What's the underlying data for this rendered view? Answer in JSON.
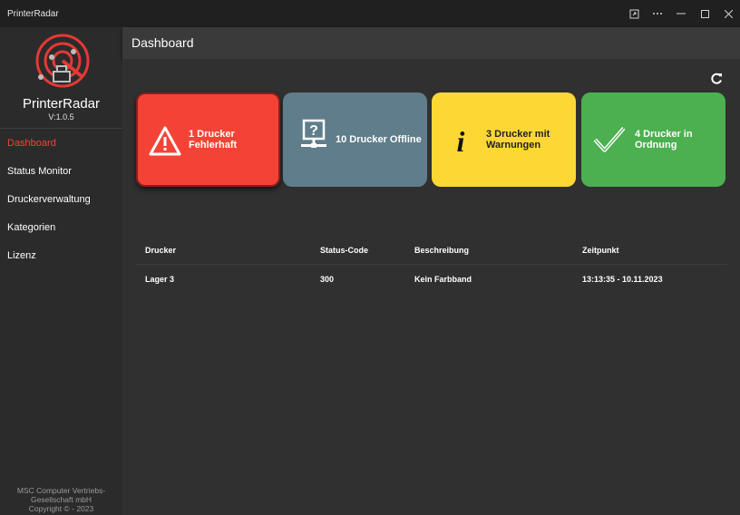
{
  "window": {
    "title": "PrinterRadar",
    "controls": [
      "restore-icon",
      "more-icon",
      "minimize-icon",
      "maximize-icon",
      "close-icon"
    ]
  },
  "sidebar": {
    "app_name": "PrinterRadar",
    "version": "V:1.0.5",
    "items": [
      {
        "label": "Dashboard",
        "active": true
      },
      {
        "label": "Status Monitor",
        "active": false
      },
      {
        "label": "Druckerverwaltung",
        "active": false
      },
      {
        "label": "Kategorien",
        "active": false
      },
      {
        "label": "Lizenz",
        "active": false
      }
    ],
    "copyright": [
      "MSC Computer Vertriebs-",
      "Gesellschaft mbH",
      "Copyright © - 2023"
    ]
  },
  "header": {
    "title": "Dashboard"
  },
  "cards": [
    {
      "line1": "1 Drucker",
      "line2": "Fehlerhaft",
      "icon": "warning-triangle-icon",
      "color": "#f44336"
    },
    {
      "line1": "10 Drucker Offline",
      "line2": "",
      "icon": "offline-network-icon",
      "color": "#607d8b"
    },
    {
      "line1": "3 Drucker mit",
      "line2": "Warnungen",
      "icon": "info-icon",
      "color": "#fdd835"
    },
    {
      "line1": "4 Drucker in",
      "line2": "Ordnung",
      "icon": "checkmark-icon",
      "color": "#4caf50"
    }
  ],
  "table": {
    "columns": [
      "Drucker",
      "Status-Code",
      "Beschreibung",
      "Zeitpunkt"
    ],
    "rows": [
      [
        "Lager 3",
        "300",
        "Kein Farbband",
        "13:13:35 - 10.11.2023"
      ]
    ]
  },
  "colors": {
    "accent": "#f44336",
    "sidebar_bg": "#2b2b2b",
    "main_bg": "#303030"
  }
}
